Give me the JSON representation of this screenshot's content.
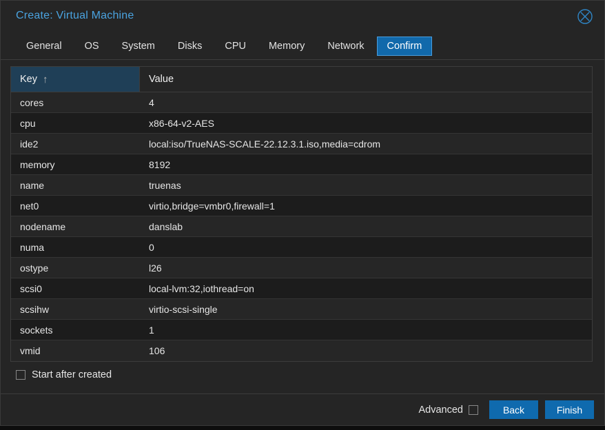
{
  "dialog": {
    "title": "Create: Virtual Machine",
    "close_icon": "close-circle-icon"
  },
  "tabs": [
    {
      "label": "General",
      "active": false
    },
    {
      "label": "OS",
      "active": false
    },
    {
      "label": "System",
      "active": false
    },
    {
      "label": "Disks",
      "active": false
    },
    {
      "label": "CPU",
      "active": false
    },
    {
      "label": "Memory",
      "active": false
    },
    {
      "label": "Network",
      "active": false
    },
    {
      "label": "Confirm",
      "active": true
    }
  ],
  "grid": {
    "columns": [
      {
        "label": "Key",
        "sorted": true,
        "sort_indicator": "↑"
      },
      {
        "label": "Value",
        "sorted": false,
        "sort_indicator": ""
      }
    ],
    "rows": [
      {
        "key": "cores",
        "value": "4"
      },
      {
        "key": "cpu",
        "value": "x86-64-v2-AES"
      },
      {
        "key": "ide2",
        "value": "local:iso/TrueNAS-SCALE-22.12.3.1.iso,media=cdrom"
      },
      {
        "key": "memory",
        "value": "8192"
      },
      {
        "key": "name",
        "value": "truenas"
      },
      {
        "key": "net0",
        "value": "virtio,bridge=vmbr0,firewall=1"
      },
      {
        "key": "nodename",
        "value": "danslab"
      },
      {
        "key": "numa",
        "value": "0"
      },
      {
        "key": "ostype",
        "value": "l26"
      },
      {
        "key": "scsi0",
        "value": "local-lvm:32,iothread=on"
      },
      {
        "key": "scsihw",
        "value": "virtio-scsi-single"
      },
      {
        "key": "sockets",
        "value": "1"
      },
      {
        "key": "vmid",
        "value": "106"
      }
    ]
  },
  "options": {
    "start_after_created_label": "Start after created",
    "start_after_created_checked": false,
    "advanced_label": "Advanced",
    "advanced_checked": false
  },
  "footer": {
    "back_label": "Back",
    "finish_label": "Finish"
  },
  "colors": {
    "accent_blue": "#0f6aae",
    "title_blue": "#4aa3e0",
    "active_tab_bg": "#1169ab",
    "active_tab_border": "#4a9ede",
    "sorted_col_bg": "#1f3f57",
    "dialog_bg": "#252525",
    "row_odd": "#262626",
    "row_even": "#1c1c1c"
  }
}
